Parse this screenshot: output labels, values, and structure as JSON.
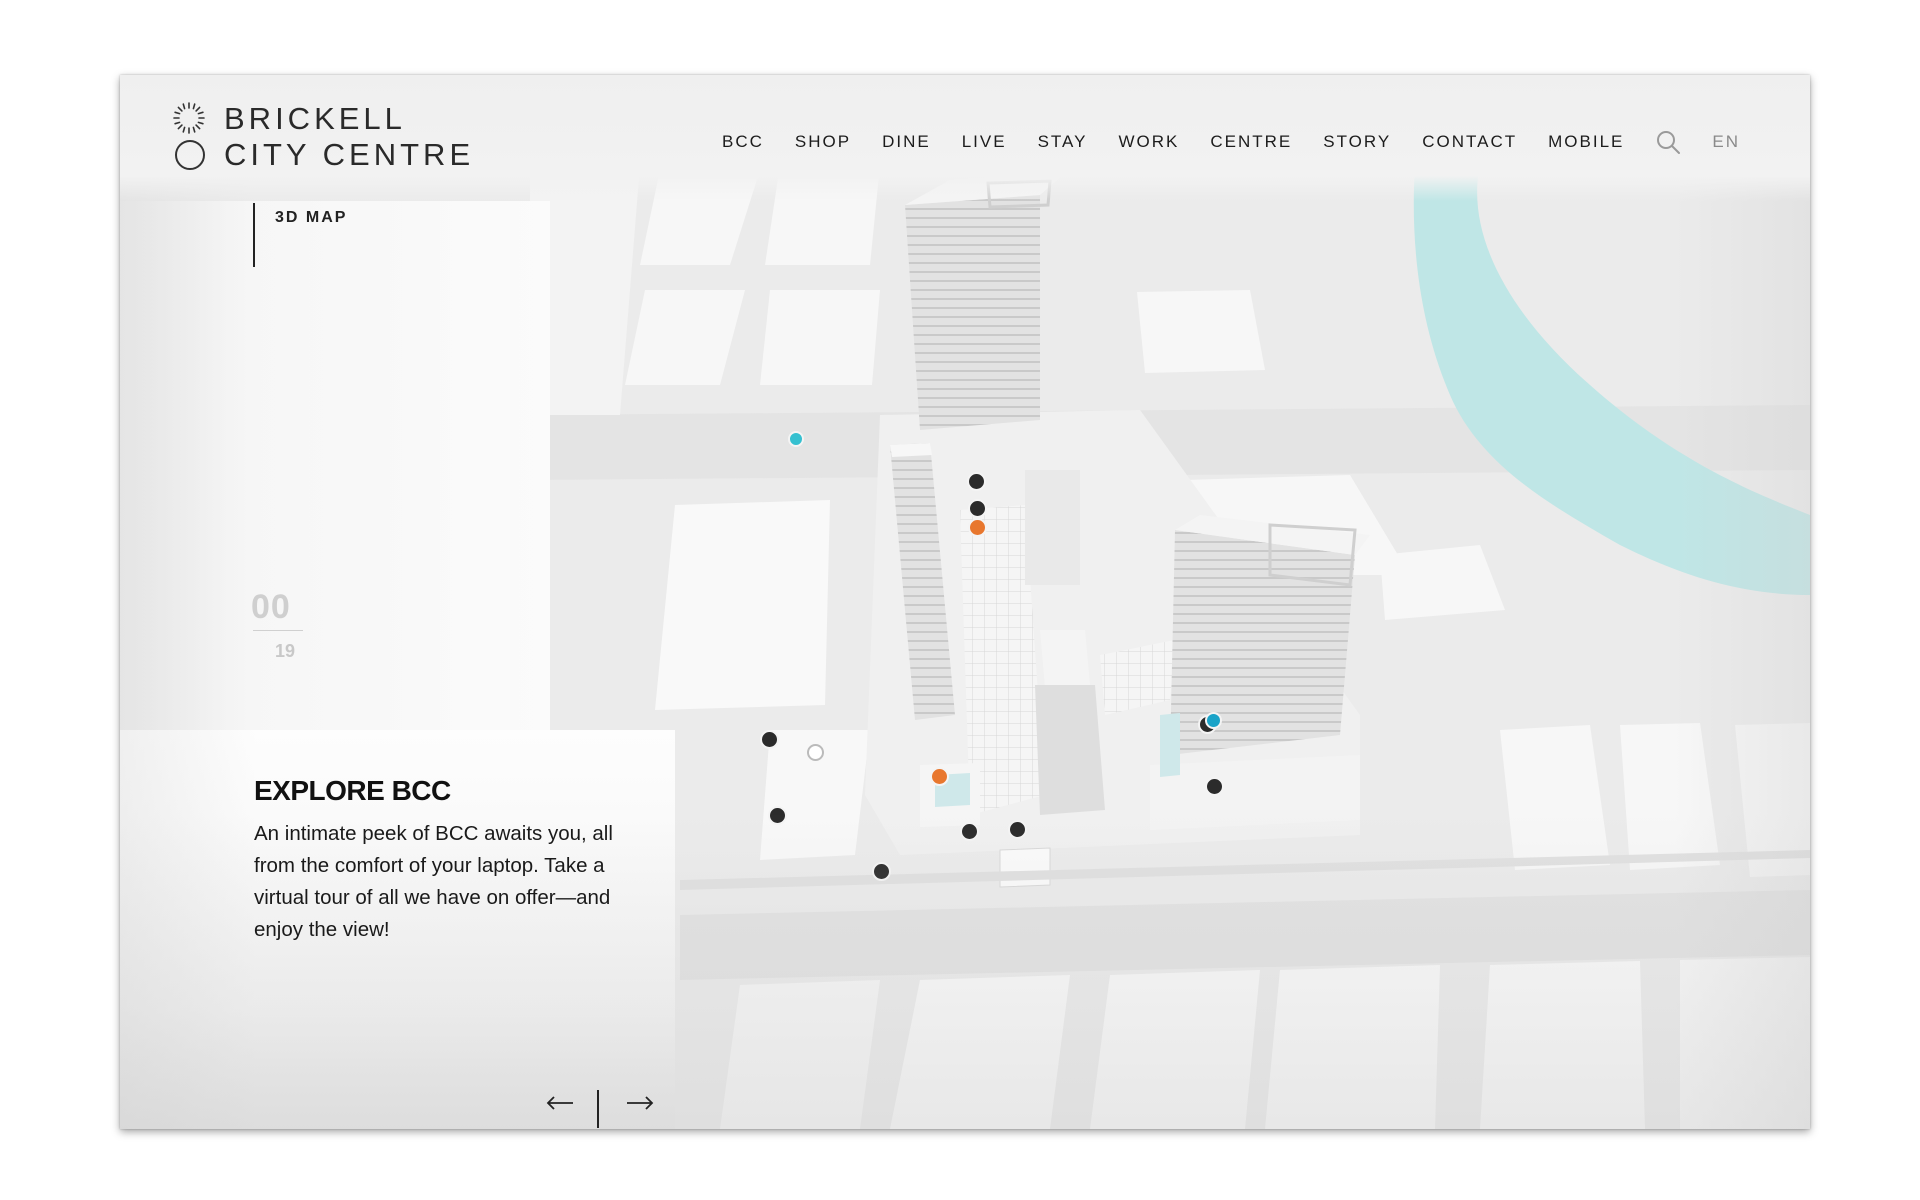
{
  "brand": {
    "line1": "BRICKELL",
    "line2": "CITY CENTRE"
  },
  "nav": {
    "items": [
      "BCC",
      "SHOP",
      "DINE",
      "LIVE",
      "STAY",
      "WORK",
      "CENTRE",
      "STORY",
      "CONTACT",
      "MOBILE"
    ],
    "search_icon": "search-icon",
    "language": "EN"
  },
  "section": {
    "label": "3D MAP"
  },
  "counter": {
    "current": "00",
    "total": "19"
  },
  "explore": {
    "title": "EXPLORE BCC",
    "body": "An intimate peek of BCC awaits you, all from the comfort of your laptop. Take a virtual tour of all we have on offer—and enjoy the view!"
  },
  "pager": {
    "prev_icon": "arrow-left-icon",
    "next_icon": "arrow-right-icon"
  },
  "colors": {
    "water": "#bfe6e6",
    "marker_dark": "#2b2b2b",
    "marker_orange": "#e8772e",
    "marker_cyan": "#35c0d0",
    "marker_blue": "#1aa3c8"
  }
}
